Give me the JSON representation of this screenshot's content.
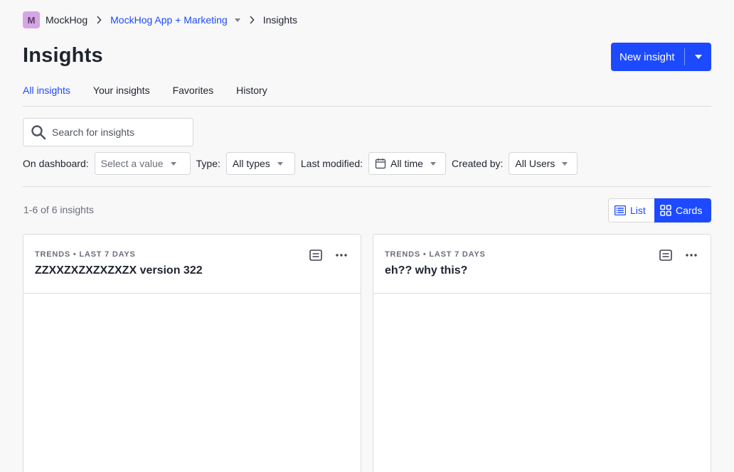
{
  "breadcrumb": {
    "org_initial": "M",
    "org_name": "MockHog",
    "project": "MockHog App + Marketing",
    "current": "Insights"
  },
  "page": {
    "title": "Insights",
    "new_insight_label": "New insight"
  },
  "tabs": [
    {
      "label": "All insights",
      "active": true
    },
    {
      "label": "Your insights",
      "active": false
    },
    {
      "label": "Favorites",
      "active": false
    },
    {
      "label": "History",
      "active": false
    }
  ],
  "search": {
    "placeholder": "Search for insights",
    "value": ""
  },
  "filters": {
    "dashboard_label": "On dashboard:",
    "dashboard_value": "Select a value",
    "type_label": "Type:",
    "type_value": "All types",
    "modified_label": "Last modified:",
    "modified_value": "All time",
    "created_label": "Created by:",
    "created_value": "All Users"
  },
  "results": {
    "count_text": "1-6 of 6 insights"
  },
  "view_toggle": {
    "list_label": "List",
    "cards_label": "Cards",
    "selected": "Cards"
  },
  "cards": [
    {
      "meta": "Trends • Last 7 days",
      "title": "ZZXXZXZXZXZXZX version 322"
    },
    {
      "meta": "Trends • Last 7 days",
      "title": "eh?? why this?"
    }
  ],
  "colors": {
    "accent": "#1d4aff",
    "avatar_bg": "#d5a6e3",
    "background": "#f8f8f8"
  }
}
